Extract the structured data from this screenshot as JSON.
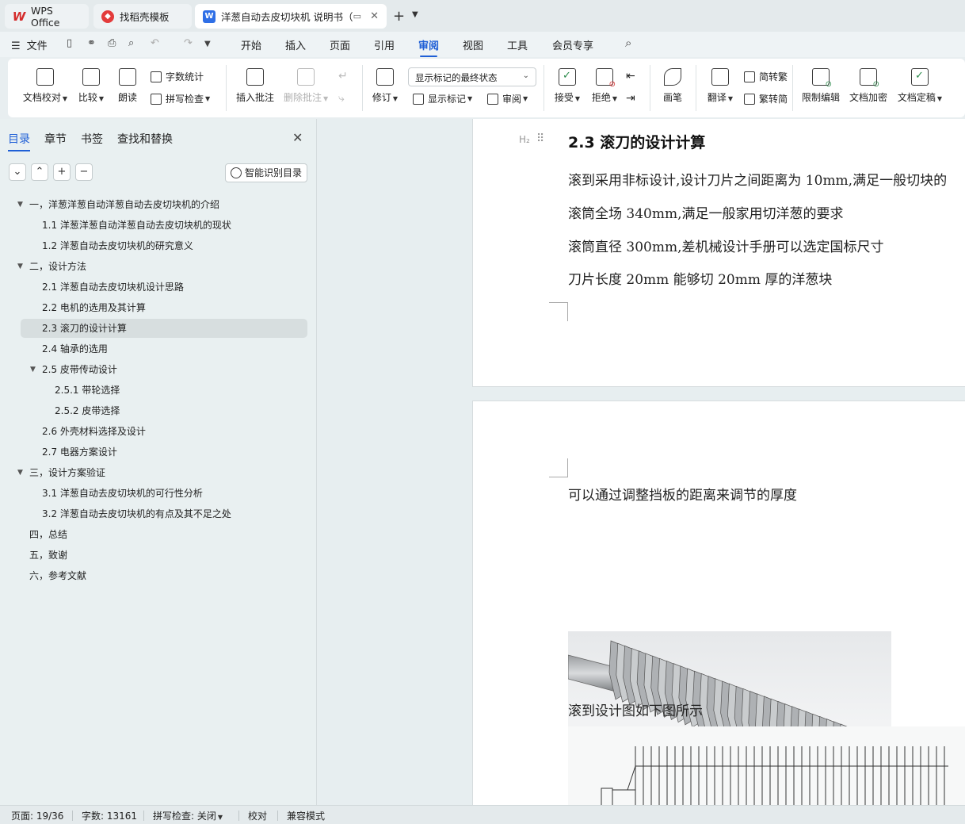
{
  "tabs": [
    {
      "label": "WPS Office",
      "icon": "wps-logo-icon"
    },
    {
      "label": "找稻壳模板",
      "icon": "docer-icon"
    },
    {
      "label": "洋葱自动去皮切块机 说明书（",
      "icon": "word-doc-icon"
    }
  ],
  "menu": {
    "file": "文件",
    "items": [
      "开始",
      "插入",
      "页面",
      "引用",
      "审阅",
      "视图",
      "工具",
      "会员专享"
    ],
    "active": "审阅"
  },
  "ribbon": {
    "doc_proof": "文档校对",
    "compare": "比较",
    "read_aloud": "朗读",
    "word_count": "字数统计",
    "spell_check": "拼写检查",
    "insert_comment": "插入批注",
    "delete_comment": "删除批注",
    "track": "修订",
    "markup_state": "显示标记的最终状态",
    "show_markup": "显示标记",
    "review": "审阅",
    "accept": "接受",
    "reject": "拒绝",
    "pen": "画笔",
    "translate": "翻译",
    "to_traditional": "简转繁",
    "to_simplified": "繁转简",
    "restrict_edit": "限制编辑",
    "encrypt": "文档加密",
    "finalize": "文档定稿"
  },
  "nav": {
    "tabs": [
      "目录",
      "章节",
      "书签",
      "查找和替换"
    ],
    "smart_toc": "智能识别目录",
    "toc": [
      {
        "text": "一，洋葱洋葱自动洋葱自动去皮切块机的介绍",
        "level": 1,
        "expanded": true
      },
      {
        "text": "1.1 洋葱洋葱自动洋葱自动去皮切块机的现状",
        "level": 2
      },
      {
        "text": "1.2 洋葱自动去皮切块机的研究意义",
        "level": 2
      },
      {
        "text": "二，设计方法",
        "level": 1,
        "expanded": true
      },
      {
        "text": "2.1 洋葱自动去皮切块机设计思路",
        "level": 2
      },
      {
        "text": "2.2 电机的选用及其计算",
        "level": 2
      },
      {
        "text": "2.3 滚刀的设计计算",
        "level": 2,
        "selected": true
      },
      {
        "text": "2.4 轴承的选用",
        "level": 2
      },
      {
        "text": "2.5 皮带传动设计",
        "level": 2,
        "expanded": true
      },
      {
        "text": "2.5.1 带轮选择",
        "level": 3
      },
      {
        "text": "2.5.2 皮带选择",
        "level": 3
      },
      {
        "text": "2.6 外壳材料选择及设计",
        "level": 2
      },
      {
        "text": "2.7 电器方案设计",
        "level": 2
      },
      {
        "text": "三，设计方案验证",
        "level": 1,
        "expanded": true
      },
      {
        "text": "3.1 洋葱自动去皮切块机的可行性分析",
        "level": 2
      },
      {
        "text": "3.2 洋葱自动去皮切块机的有点及其不足之处",
        "level": 2
      },
      {
        "text": "四，总结",
        "level": 1
      },
      {
        "text": "五，致谢",
        "level": 1
      },
      {
        "text": "六，参考文献",
        "level": 1
      }
    ]
  },
  "document": {
    "heading_mark": "H₂",
    "heading": "2.3 滚刀的设计计算",
    "lines": [
      "滚到采用非标设计,设计刀片之间距离为 10mm,满足一般切块的",
      "滚筒全场 340mm,满足一般家用切洋葱的要求",
      "滚筒直径 300mm,差机械设计手册可以选定国标尺寸",
      "刀片长度 20mm 能够切 20mm 厚的洋葱块"
    ],
    "page2_lines": [
      "可以通过调整挡板的距离来调节的厚度",
      "滚到设计图如下图所示"
    ]
  },
  "status": {
    "page": "页面: 19/36",
    "words": "字数: 13161",
    "spell": "拼写检查: 关闭",
    "proof": "校对",
    "compat": "兼容模式"
  }
}
